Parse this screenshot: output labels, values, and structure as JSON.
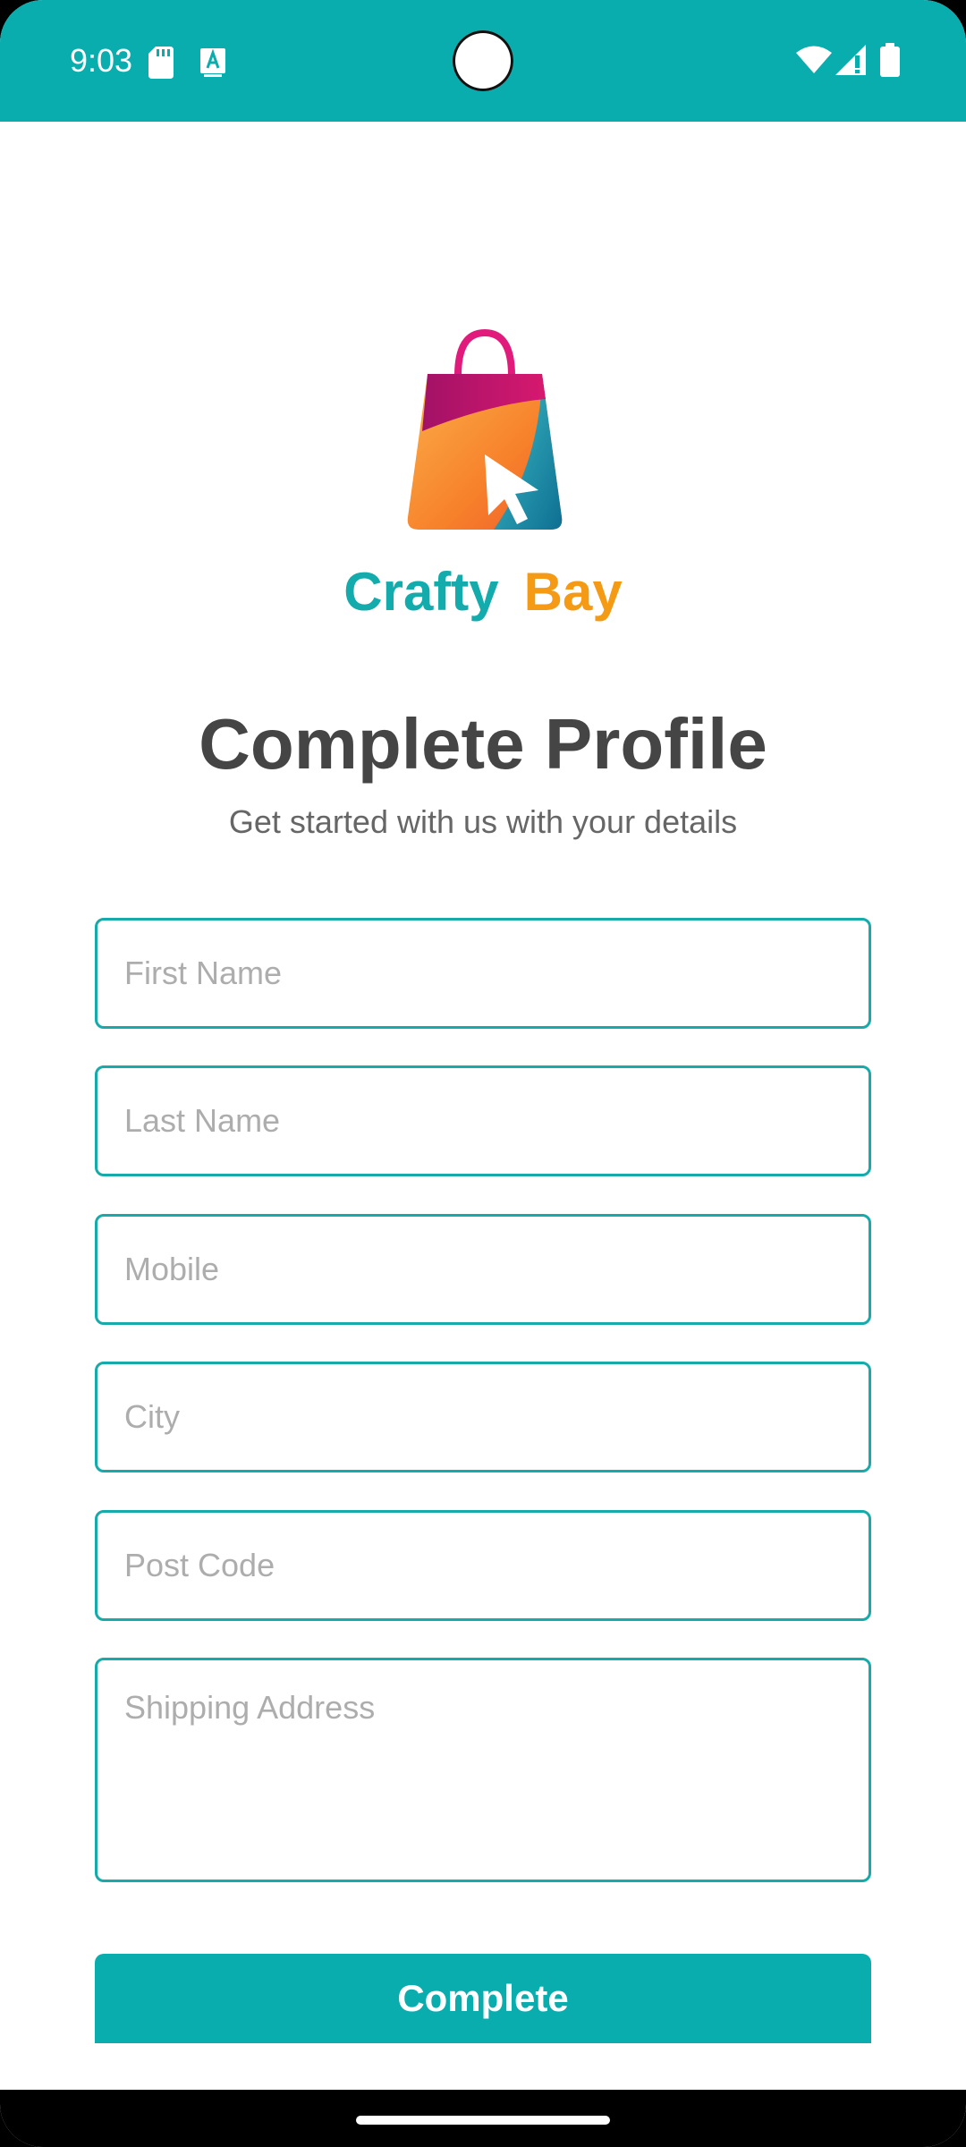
{
  "status_bar": {
    "time": "9:03",
    "icons": [
      "sd-card-icon",
      "font-a-icon",
      "wifi-icon",
      "signal-icon",
      "battery-icon"
    ]
  },
  "logo": {
    "word1": "Crafty",
    "word2": "Bay",
    "colors": {
      "word1": "#13abab",
      "word2": "#f49a14"
    }
  },
  "header": {
    "title": "Complete Profile",
    "subtitle": "Get started with us with your details"
  },
  "form": {
    "first_name": {
      "placeholder": "First Name",
      "value": ""
    },
    "last_name": {
      "placeholder": "Last Name",
      "value": ""
    },
    "mobile": {
      "placeholder": "Mobile",
      "value": ""
    },
    "city": {
      "placeholder": "City",
      "value": ""
    },
    "post_code": {
      "placeholder": "Post Code",
      "value": ""
    },
    "shipping_address": {
      "placeholder": "Shipping Address",
      "value": ""
    }
  },
  "complete_button": {
    "label": "Complete"
  },
  "colors": {
    "accent": "#0aadae",
    "title_text": "#454545",
    "placeholder": "#adadad"
  }
}
